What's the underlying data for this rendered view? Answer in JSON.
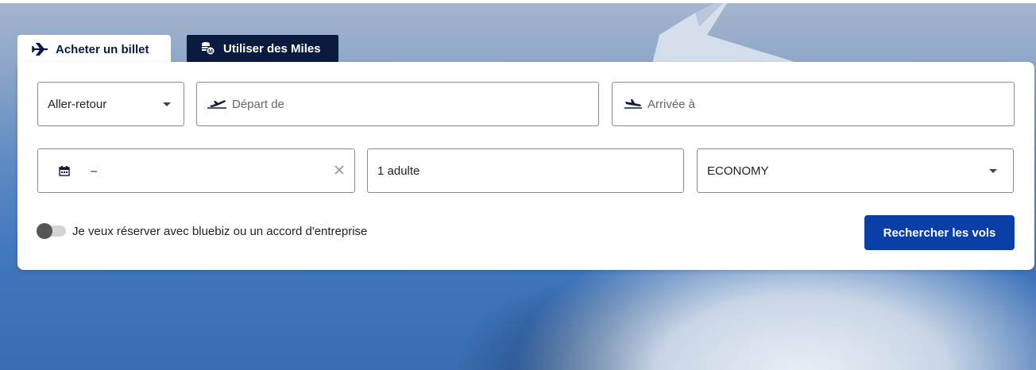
{
  "tabs": {
    "buy_label": "Acheter un billet",
    "miles_label": "Utiliser des Miles"
  },
  "form": {
    "trip_type": "Aller-retour",
    "departure_placeholder": "Départ de",
    "arrival_placeholder": "Arrivée à",
    "dates_value": "–",
    "passengers_value": "1 adulte",
    "cabin_value": "ECONOMY"
  },
  "corporate": {
    "toggle_label": "Je veux réserver avec bluebiz ou un accord d'entreprise"
  },
  "actions": {
    "search_label": "Rechercher les vols"
  },
  "colors": {
    "navy": "#0b1b3f",
    "button_blue": "#0a3fa6"
  },
  "icons": [
    "airplane-icon",
    "coins-miles-icon",
    "takeoff-icon",
    "landing-icon",
    "calendar-icon",
    "clear-icon",
    "chevron-down-icon"
  ]
}
